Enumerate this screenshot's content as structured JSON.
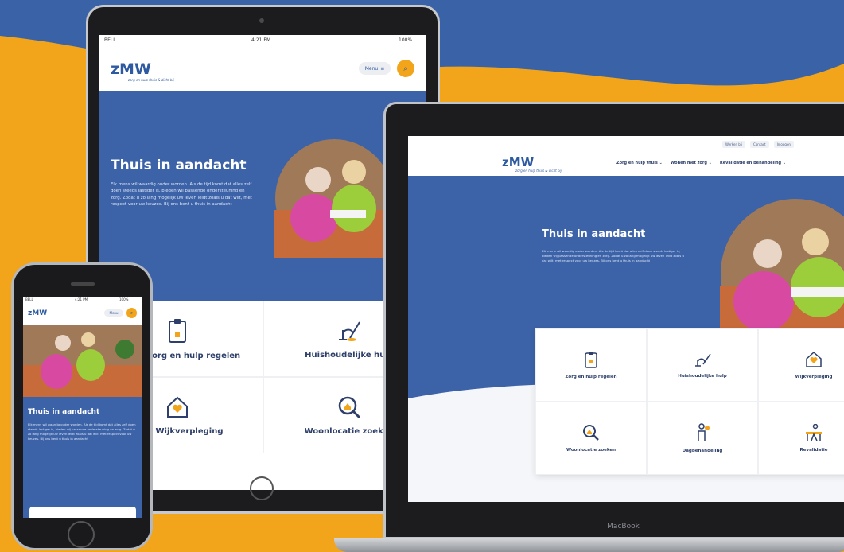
{
  "colors": {
    "brand_blue": "#3c62a8",
    "brand_dark": "#2d3f6a",
    "accent_yellow": "#f2a51a"
  },
  "brand": {
    "logo": "zMW",
    "tagline": "zorg en hulp thuis & dicht bij"
  },
  "hero": {
    "title": "Thuis in aandacht",
    "text": "Elk mens wil waardig ouder worden. Als de tijd komt dat alles zelf doen steeds lastiger is, bieden wij passende ondersteuning en zorg. Zodat u zo lang mogelijk uw leven leidt zoals u dat wilt, met respect voor uw keuzes. Bij ons bent u thuis in aandacht"
  },
  "tablet": {
    "status": {
      "carrier": "BELL",
      "time": "4:21 PM",
      "battery": "100%"
    },
    "menu_label": "Menu",
    "tiles": [
      {
        "label": "Zorg en hulp regelen",
        "icon": "clipboard-icon"
      },
      {
        "label": "Huishoudelijke hulp",
        "icon": "vacuum-icon"
      },
      {
        "label": "Wijkverpleging",
        "icon": "house-heart-icon"
      },
      {
        "label": "Woonlocatie zoeken",
        "icon": "search-house-icon"
      }
    ]
  },
  "phone": {
    "status": {
      "carrier": "BELL",
      "time": "4:21 PM",
      "battery": "100%"
    },
    "menu_label": "Menu"
  },
  "laptop": {
    "topbar": [
      "Werken bij",
      "Contact",
      "Inloggen"
    ],
    "nav": [
      "Zorg en hulp thuis",
      "Wonen met zorg",
      "Revalidatie en behandeling"
    ],
    "tiles": [
      {
        "label": "Zorg en hulp regelen",
        "icon": "clipboard-icon"
      },
      {
        "label": "Huishoudelijke hulp",
        "icon": "vacuum-icon"
      },
      {
        "label": "Wijkverpleging",
        "icon": "house-heart-icon"
      },
      {
        "label": "Woonlocatie zoeken",
        "icon": "search-house-icon"
      },
      {
        "label": "Dagbehandeling",
        "icon": "person-icon"
      },
      {
        "label": "Revalidatie",
        "icon": "rehab-icon"
      }
    ],
    "model": "MacBook"
  }
}
